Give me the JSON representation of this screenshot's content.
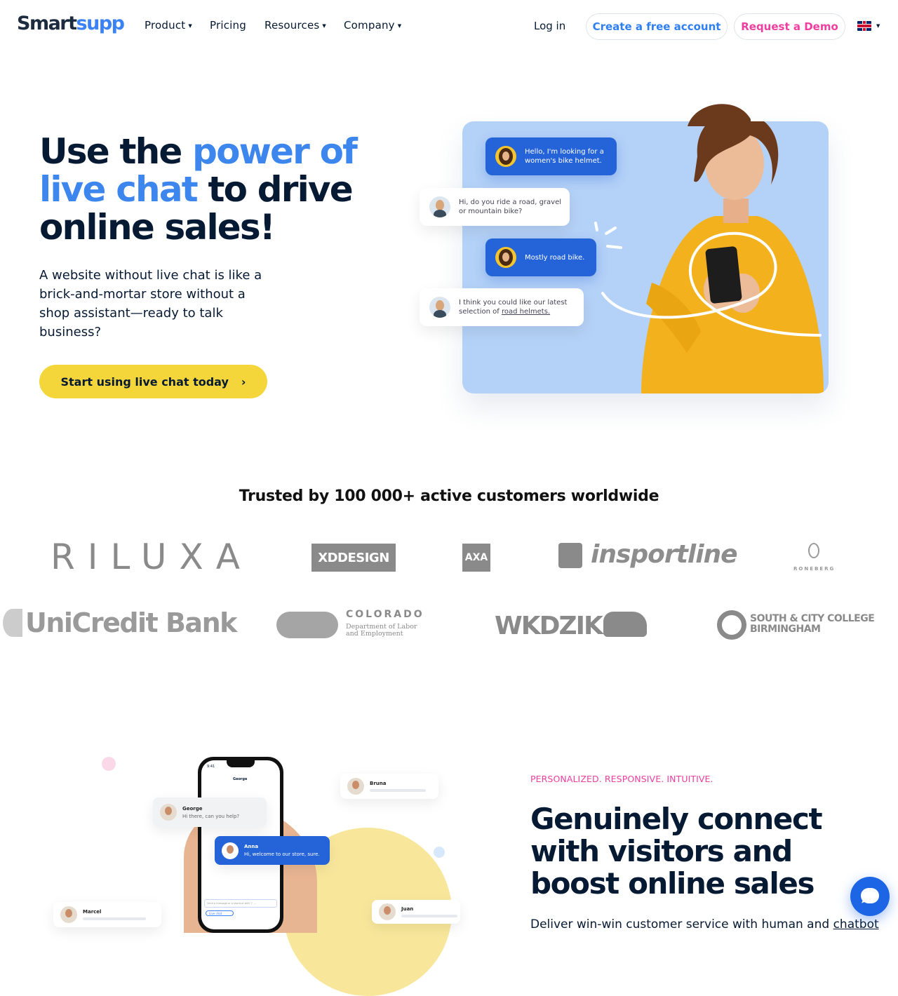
{
  "header": {
    "logo": {
      "part1": "Smart",
      "part2": "supp"
    },
    "nav": [
      {
        "label": "Product",
        "dropdown": true
      },
      {
        "label": "Pricing",
        "dropdown": false
      },
      {
        "label": "Resources",
        "dropdown": true
      },
      {
        "label": "Company",
        "dropdown": true
      }
    ],
    "login": "Log in",
    "create_account": "Create a free account",
    "request_demo": "Request a Demo",
    "language_icon": "uk-flag-icon"
  },
  "hero": {
    "title_part1": "Use the ",
    "title_highlight": "power of live chat",
    "title_part2": " to drive online sales!",
    "description": "A website without live chat is like a brick-and-mortar store without a shop assistant—ready to talk business?",
    "cta": "Start using live chat today",
    "cta_icon": "chevron-right-icon",
    "chat": [
      {
        "from": "visitor",
        "text": "Hello, I'm looking for a women's bike helmet."
      },
      {
        "from": "agent",
        "text": "Hi, do you ride a road, gravel or mountain bike?"
      },
      {
        "from": "visitor",
        "text": "Mostly road bike."
      },
      {
        "from": "agent",
        "text_before": "I think you could like our latest selection of ",
        "link": "road helmets."
      }
    ]
  },
  "trusted": {
    "heading": "Trusted by 100 000+ active customers worldwide",
    "logos": [
      "RILUXA",
      "XDDESIGN",
      "AXA",
      "insportline",
      "RONEBERG",
      "UniCredit Bank",
      "COLORADO",
      "Department of Labor and Employment",
      "WKDZIK",
      "SOUTH & CITY COLLEGE",
      "BIRMINGHAM"
    ]
  },
  "section2": {
    "eyebrow": "PERSONALIZED. RESPONSIVE. INTUITIVE.",
    "title": "Genuinely connect with visitors and boost online sales",
    "text_before": "Deliver win-win customer service with human and ",
    "text_link": "chatbot",
    "mockup": {
      "phone_time": "9:41",
      "phone_contact": "George",
      "george_name": "George",
      "george_msg": "Hi there, can you help?",
      "anna_name": "Anna",
      "anna_msg": "Hi, welcome to our store, sure.",
      "bruna": "Bruna",
      "marcel": "Marcel",
      "juan": "Juan",
      "input_placeholder": "Send a message or a shortcut with ‘/’ ...",
      "channel": "Live chat"
    }
  },
  "chat_widget_icon": "chat-bubble-icon"
}
